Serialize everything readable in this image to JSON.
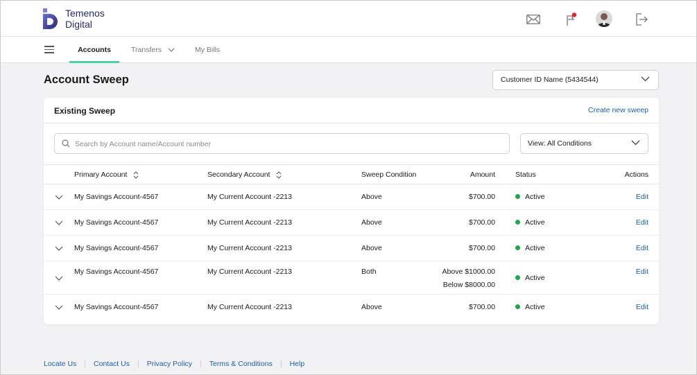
{
  "brand": {
    "line1": "Temenos",
    "line2": "Digital"
  },
  "header_icons": [
    "mail-icon",
    "flag-icon",
    "avatar",
    "logout-icon"
  ],
  "nav": {
    "tabs": [
      {
        "label": "Accounts",
        "active": true
      },
      {
        "label": "Transfers",
        "has_dropdown": true
      },
      {
        "label": "My Bills"
      }
    ]
  },
  "page": {
    "title": "Account Sweep",
    "customer_select": "Customer ID Name (5434544)"
  },
  "card": {
    "title": "Existing Sweep",
    "create_link": "Create new sweep",
    "search_placeholder": "Search by Account name/Account number",
    "view_filter": "View: All Conditions"
  },
  "table": {
    "columns": [
      "Primary Account",
      "Secondary Account",
      "Sweep Condition",
      "Amount",
      "Status",
      "Actions"
    ],
    "rows": [
      {
        "primary": "My Savings Account-4567",
        "secondary": "My Current Account -2213",
        "condition": "Above",
        "amount": "$700.00",
        "amount2": "",
        "status": "Active",
        "action": "Edit"
      },
      {
        "primary": "My Savings Account-4567",
        "secondary": "My Current Account -2213",
        "condition": "Above",
        "amount": "$700.00",
        "amount2": "",
        "status": "Active",
        "action": "Edit"
      },
      {
        "primary": "My Savings Account-4567",
        "secondary": "My Current Account -2213",
        "condition": "Above",
        "amount": "$700.00",
        "amount2": "",
        "status": "Active",
        "action": "Edit"
      },
      {
        "primary": "My Savings Account-4567",
        "secondary": "My Current Account -2213",
        "condition": "Both",
        "amount": "Above $1000.00",
        "amount2": "Below $8000.00",
        "status": "Active",
        "action": "Edit"
      },
      {
        "primary": "My Savings Account-4567",
        "secondary": "My Current Account -2213",
        "condition": "Above",
        "amount": "$700.00",
        "amount2": "",
        "status": "Active",
        "action": "Edit"
      }
    ]
  },
  "footer": {
    "links": [
      "Locate Us",
      "Contact Us",
      "Privacy Policy",
      "Terms & Conditions",
      "Help"
    ]
  },
  "colors": {
    "accent": "#4fd1a5",
    "link": "#1b5fa8",
    "active_status": "#1aa84a",
    "brand": "#262a6b"
  }
}
